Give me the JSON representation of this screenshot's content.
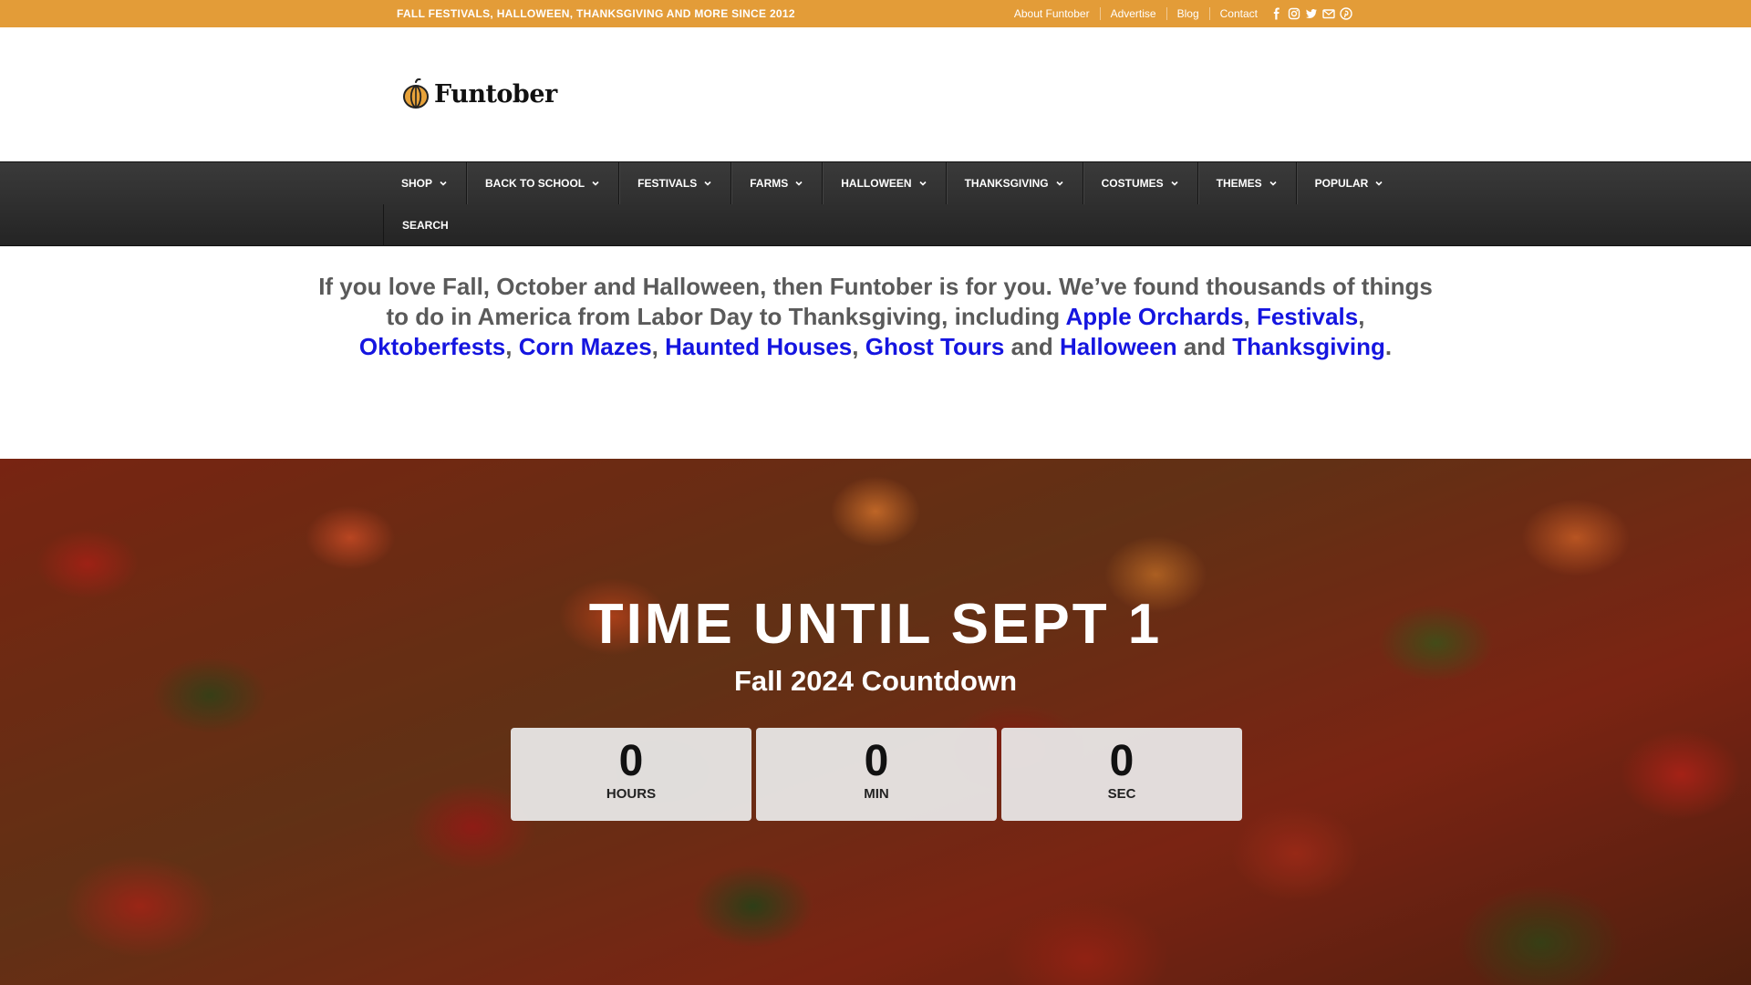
{
  "topbar": {
    "tagline": "FALL FESTIVALS, HALLOWEEN, THANKSGIVING AND MORE SINCE 2012",
    "links": [
      "About Funtober",
      "Advertise",
      "Blog",
      "Contact"
    ],
    "social_icons": [
      "facebook-icon",
      "instagram-icon",
      "twitter-icon",
      "email-icon",
      "pinterest-icon"
    ],
    "background_color": "#e39c38"
  },
  "header": {
    "logo_text": "Funtober"
  },
  "nav": {
    "row1": [
      {
        "label": "SHOP"
      },
      {
        "label": "BACK TO SCHOOL"
      },
      {
        "label": "FESTIVALS"
      },
      {
        "label": "FARMS"
      },
      {
        "label": "HALLOWEEN"
      },
      {
        "label": "THANKSGIVING"
      },
      {
        "label": "COSTUMES"
      },
      {
        "label": "THEMES"
      },
      {
        "label": "POPULAR"
      }
    ],
    "row2": [
      {
        "label": "SEARCH"
      }
    ]
  },
  "intro": {
    "part1": "If you love Fall, October and Halloween, then Funtober is for you.  We’ve found thousands of things to do in America from Labor Day to Thanksgiving, including ",
    "links": [
      "Apple Orchards",
      "Festivals",
      "Oktoberfests",
      "Corn Mazes",
      "Haunted Houses",
      "Ghost Tours",
      "Halloween",
      "Thanksgiving"
    ],
    "sep_comma": ", ",
    "sep_and": " and ",
    "end": ".",
    "link_color": "#1515e0"
  },
  "hero": {
    "title": "TIME UNTIL SEPT 1",
    "subtitle": "Fall 2024 Countdown",
    "countdown": [
      {
        "value": "0",
        "label": "HOURS"
      },
      {
        "value": "0",
        "label": "MIN"
      },
      {
        "value": "0",
        "label": "SEC"
      }
    ]
  }
}
